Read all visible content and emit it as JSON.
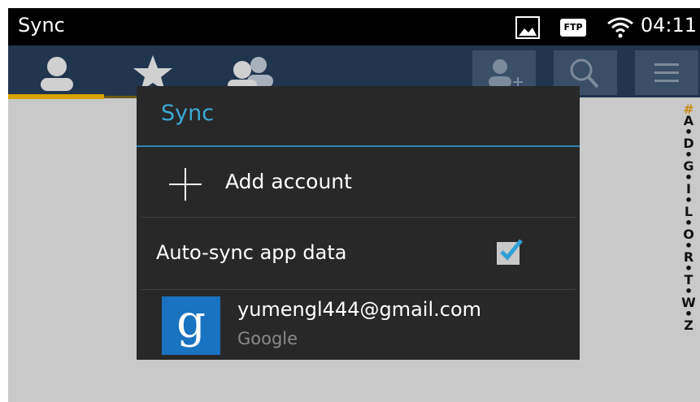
{
  "status_bar": {
    "title": "Sync",
    "time": "04:11",
    "icons": [
      "gallery-icon",
      "ftp-icon",
      "wifi-icon"
    ],
    "ftp_label": "FTP"
  },
  "action_bar": {
    "tabs": [
      "contacts-tab-icon",
      "favorites-tab-icon",
      "groups-tab-icon"
    ],
    "buttons": [
      "add-contact-icon",
      "search-icon",
      "menu-icon"
    ],
    "accent_color": "#d9a400"
  },
  "alpha_index": [
    "#",
    "A",
    "•",
    "D",
    "•",
    "G",
    "•",
    "I",
    "•",
    "L",
    "•",
    "O",
    "•",
    "R",
    "•",
    "T",
    "•",
    "W",
    "•",
    "Z"
  ],
  "dialog": {
    "title": "Sync",
    "add_account_label": "Add account",
    "auto_sync_label": "Auto-sync app data",
    "auto_sync_checked": true,
    "account": {
      "email": "yumengl444@gmail.com",
      "type": "Google",
      "logo_letter": "g"
    },
    "title_color": "#3aa9d6"
  }
}
